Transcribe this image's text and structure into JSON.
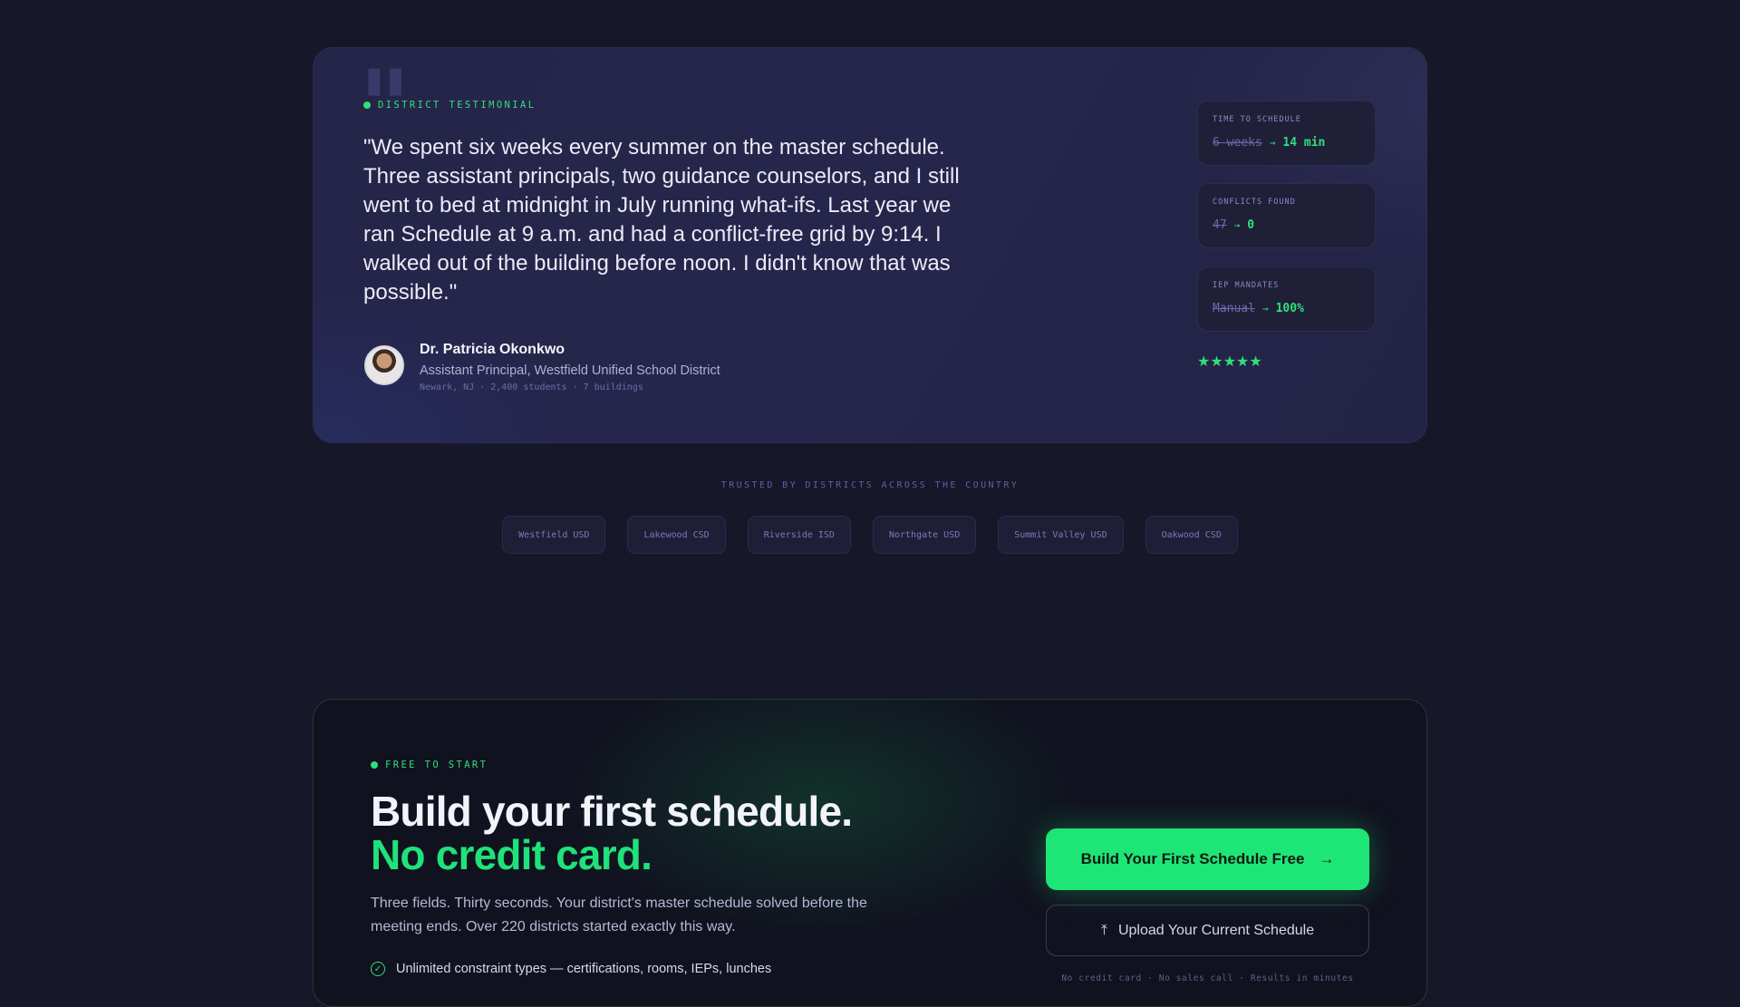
{
  "testimonial": {
    "eyebrow": "DISTRICT TESTIMONIAL",
    "quote": "\"We spent six weeks every summer on the master schedule. Three assistant principals, two guidance counselors, and I still went to bed at midnight in July running what-ifs. Last year we ran Schedule at 9 a.m. and had a conflict-free grid by 9:14. I walked out of the building before noon. I didn't know that was possible.\"",
    "author": {
      "name": "Dr. Patricia Okonkwo",
      "role": "Assistant Principal, Westfield Unified School District",
      "meta": "Newark, NJ · 2,400 students · 7 buildings"
    },
    "stats": [
      {
        "label": "TIME TO SCHEDULE",
        "old": "6 weeks",
        "arrow": "→",
        "new": "14 min"
      },
      {
        "label": "CONFLICTS FOUND",
        "old": "47",
        "arrow": "→",
        "new": "0"
      },
      {
        "label": "IEP MANDATES",
        "old": "Manual",
        "arrow": "→",
        "new": "100%"
      }
    ],
    "stars": "★★★★★",
    "rating": 5
  },
  "trusted": {
    "label": "TRUSTED BY DISTRICTS ACROSS THE COUNTRY",
    "districts": [
      "Westfield USD",
      "Lakewood CSD",
      "Riverside ISD",
      "Northgate USD",
      "Summit Valley USD",
      "Oakwood CSD"
    ]
  },
  "cta": {
    "eyebrow": "FREE TO START",
    "title_line1": "Build your first schedule.",
    "title_line2": "No credit card.",
    "description": "Three fields. Thirty seconds. Your district's master schedule solved before the meeting ends. Over 220 districts started exactly this way.",
    "feature": "Unlimited constraint types — certifications, rooms, IEPs, lunches",
    "primary_button": "Build Your First Schedule Free",
    "primary_arrow": "→",
    "secondary_button": "Upload Your Current Schedule",
    "upload_glyph": "⤒",
    "check_glyph": "✓",
    "fineprint": "No credit card · No sales call · Results in minutes"
  },
  "colors": {
    "accent": "#1ee676",
    "background": "#17172a",
    "card": "#25254a"
  }
}
